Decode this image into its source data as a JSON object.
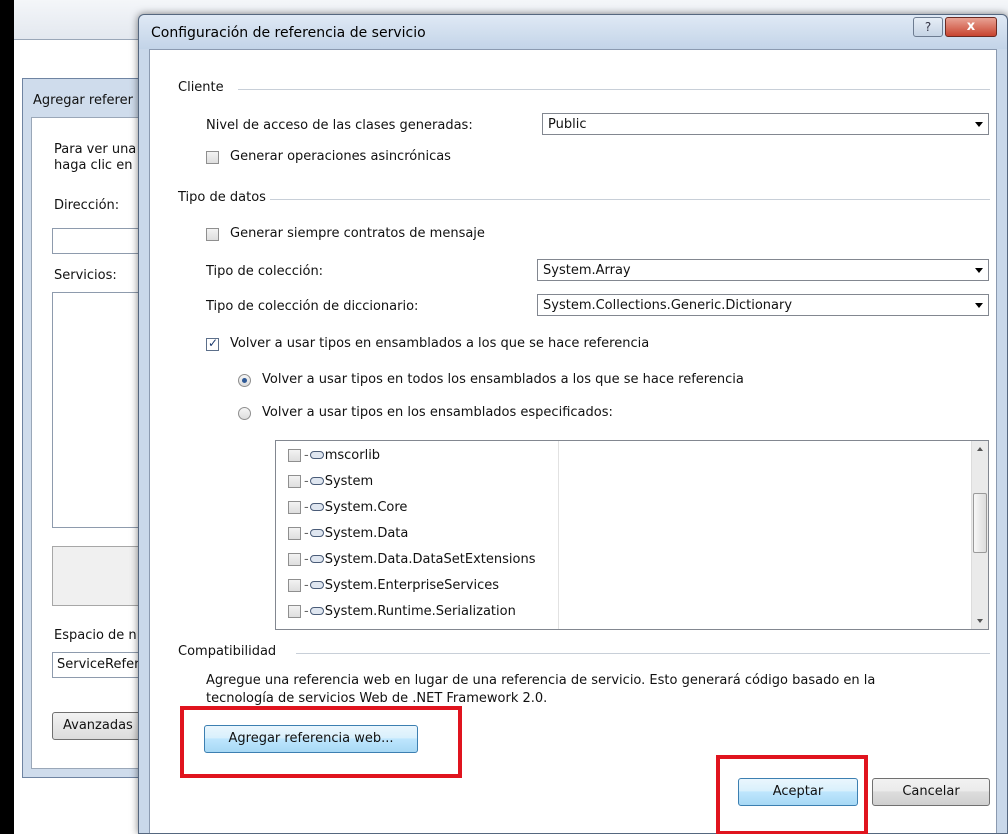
{
  "background_dialog": {
    "title": "Agregar referer",
    "instructions_line1": "Para ver una",
    "instructions_line2": "haga clic en",
    "address_label": "Dirección:",
    "services_label": "Servicios:",
    "namespace_label": "Espacio de n",
    "namespace_value": "ServiceRefer",
    "advanced_button": "Avanzadas"
  },
  "dialog": {
    "title": "Configuración de referencia de servicio",
    "help_label": "?",
    "close_label": "x"
  },
  "client_section": {
    "legend": "Cliente",
    "access_level_label": "Nivel de acceso de las clases generadas:",
    "access_level_value": "Public",
    "async_label": "Generar operaciones asincrónicas",
    "async_checked": false
  },
  "data_type_section": {
    "legend": "Tipo de datos",
    "message_contracts_label": "Generar siempre contratos de mensaje",
    "message_contracts_checked": false,
    "collection_type_label": "Tipo de colección:",
    "collection_type_value": "System.Array",
    "dictionary_type_label": "Tipo de colección de diccionario:",
    "dictionary_type_value": "System.Collections.Generic.Dictionary",
    "reuse_types_label": "Volver a usar tipos en ensamblados a los que se hace referencia",
    "reuse_types_checked": true,
    "reuse_all_label": "Volver a usar tipos en todos los ensamblados a los que se hace referencia",
    "reuse_all_selected": true,
    "reuse_specified_label": "Volver a usar tipos en los ensamblados especificados:",
    "reuse_specified_selected": false,
    "assemblies": [
      {
        "name": "mscorlib",
        "checked": false
      },
      {
        "name": "System",
        "checked": false
      },
      {
        "name": "System.Core",
        "checked": false
      },
      {
        "name": "System.Data",
        "checked": false
      },
      {
        "name": "System.Data.DataSetExtensions",
        "checked": false
      },
      {
        "name": "System.EnterpriseServices",
        "checked": false
      },
      {
        "name": "System.Runtime.Serialization",
        "checked": false
      }
    ]
  },
  "compat_section": {
    "legend": "Compatibilidad",
    "description_line1": "Agregue una referencia web en lugar de una referencia de servicio. Esto generará código basado en la",
    "description_line2": "tecnología de servicios Web de .NET Framework 2.0.",
    "add_web_ref_button": "Agregar referencia web..."
  },
  "footer": {
    "ok_button": "Aceptar",
    "cancel_button": "Cancelar"
  },
  "colors": {
    "highlight_box": "#e0141e",
    "title_bar": "#c9d8ea",
    "default_button": "#bee6fd"
  },
  "icons": {
    "assembly_reference": "reference-icon",
    "help": "help-icon",
    "close": "close-icon"
  }
}
